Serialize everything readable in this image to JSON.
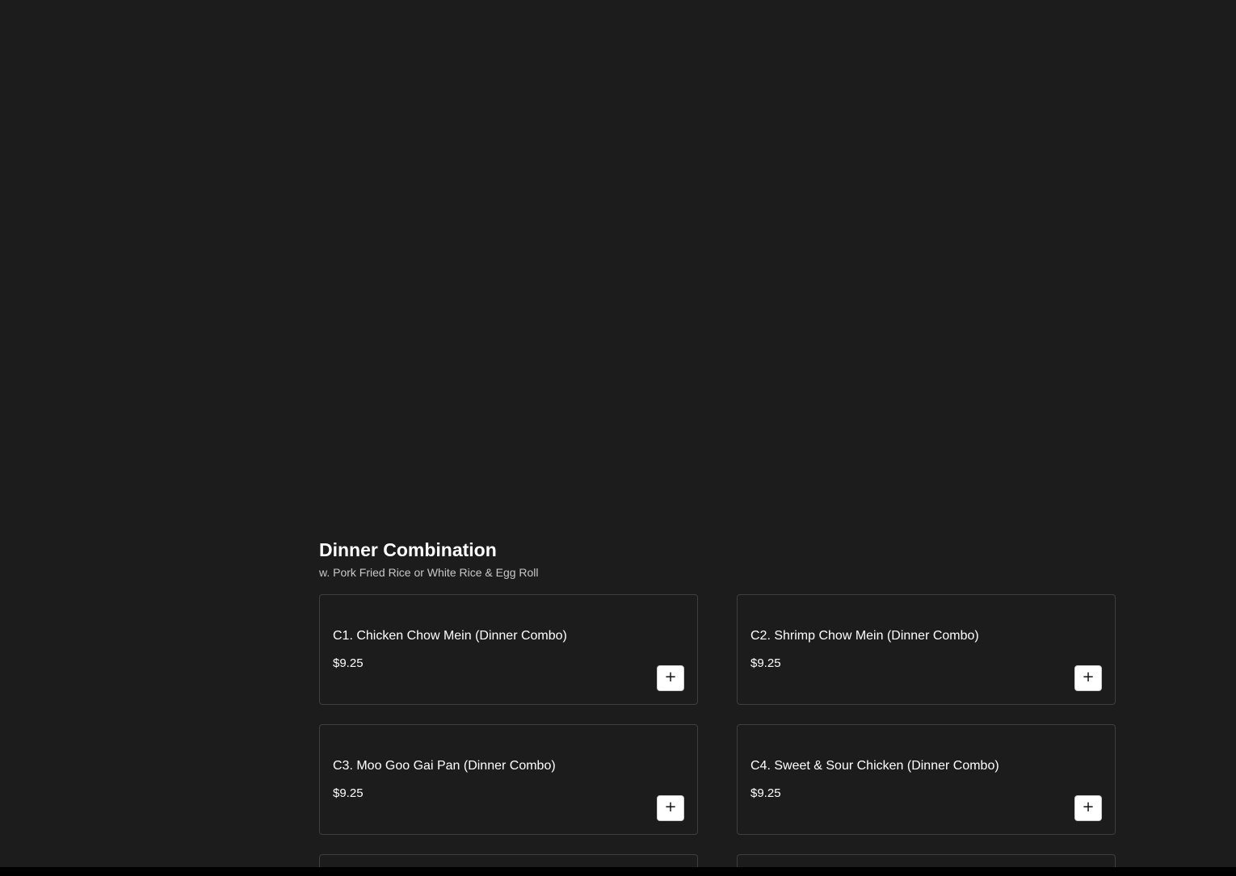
{
  "section": {
    "title": "Dinner Combination",
    "subtitle": "w. Pork Fried Rice or White Rice & Egg Roll"
  },
  "items": [
    {
      "name": "C1. Chicken Chow Mein (Dinner Combo)",
      "price": "$9.25",
      "add_label": "+"
    },
    {
      "name": "C2. Shrimp Chow Mein (Dinner Combo)",
      "price": "$9.25",
      "add_label": "+"
    },
    {
      "name": "C3. Moo Goo Gai Pan (Dinner Combo)",
      "price": "$9.25",
      "add_label": "+"
    },
    {
      "name": "C4. Sweet & Sour Chicken (Dinner Combo)",
      "price": "$9.25",
      "add_label": "+"
    }
  ],
  "icons": {
    "add": "plus-icon"
  },
  "colors": {
    "background": "#1c1c1d",
    "card_border": "#3f3f41",
    "text": "#ffffff",
    "subtitle_text": "#c8c8c8",
    "button_background": "#ffffff"
  }
}
